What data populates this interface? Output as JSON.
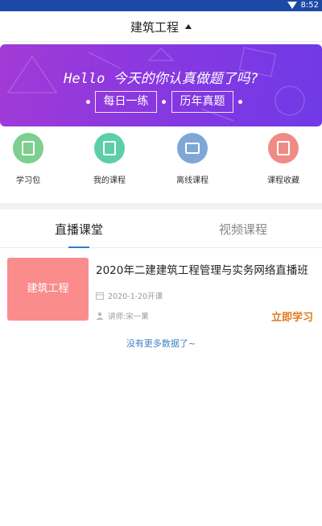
{
  "status_bar": {
    "time": "8:52"
  },
  "header": {
    "title": "建筑工程"
  },
  "banner": {
    "headline": "Hello 今天的你认真做题了吗?",
    "buttons": [
      "每日一练",
      "历年真题"
    ]
  },
  "quick_links": [
    {
      "label": "学习包",
      "icon": "book-icon",
      "color": "#7ccf8e"
    },
    {
      "label": "我的课程",
      "icon": "my-course-icon",
      "color": "#5dcfa7"
    },
    {
      "label": "离线课程",
      "icon": "offline-course-icon",
      "color": "#7ea7d8"
    },
    {
      "label": "课程收藏",
      "icon": "favorite-course-icon",
      "color": "#f08a85"
    }
  ],
  "tabs": [
    {
      "label": "直播课堂",
      "active": true
    },
    {
      "label": "视频课程",
      "active": false
    }
  ],
  "course": {
    "thumb_label": "建筑工程",
    "title": "2020年二建建筑工程管理与实务网络直播班",
    "date": "2020-1-20开课",
    "teacher": "讲师:宋一果",
    "action": "立即学习"
  },
  "footer_text": "没有更多数据了~"
}
